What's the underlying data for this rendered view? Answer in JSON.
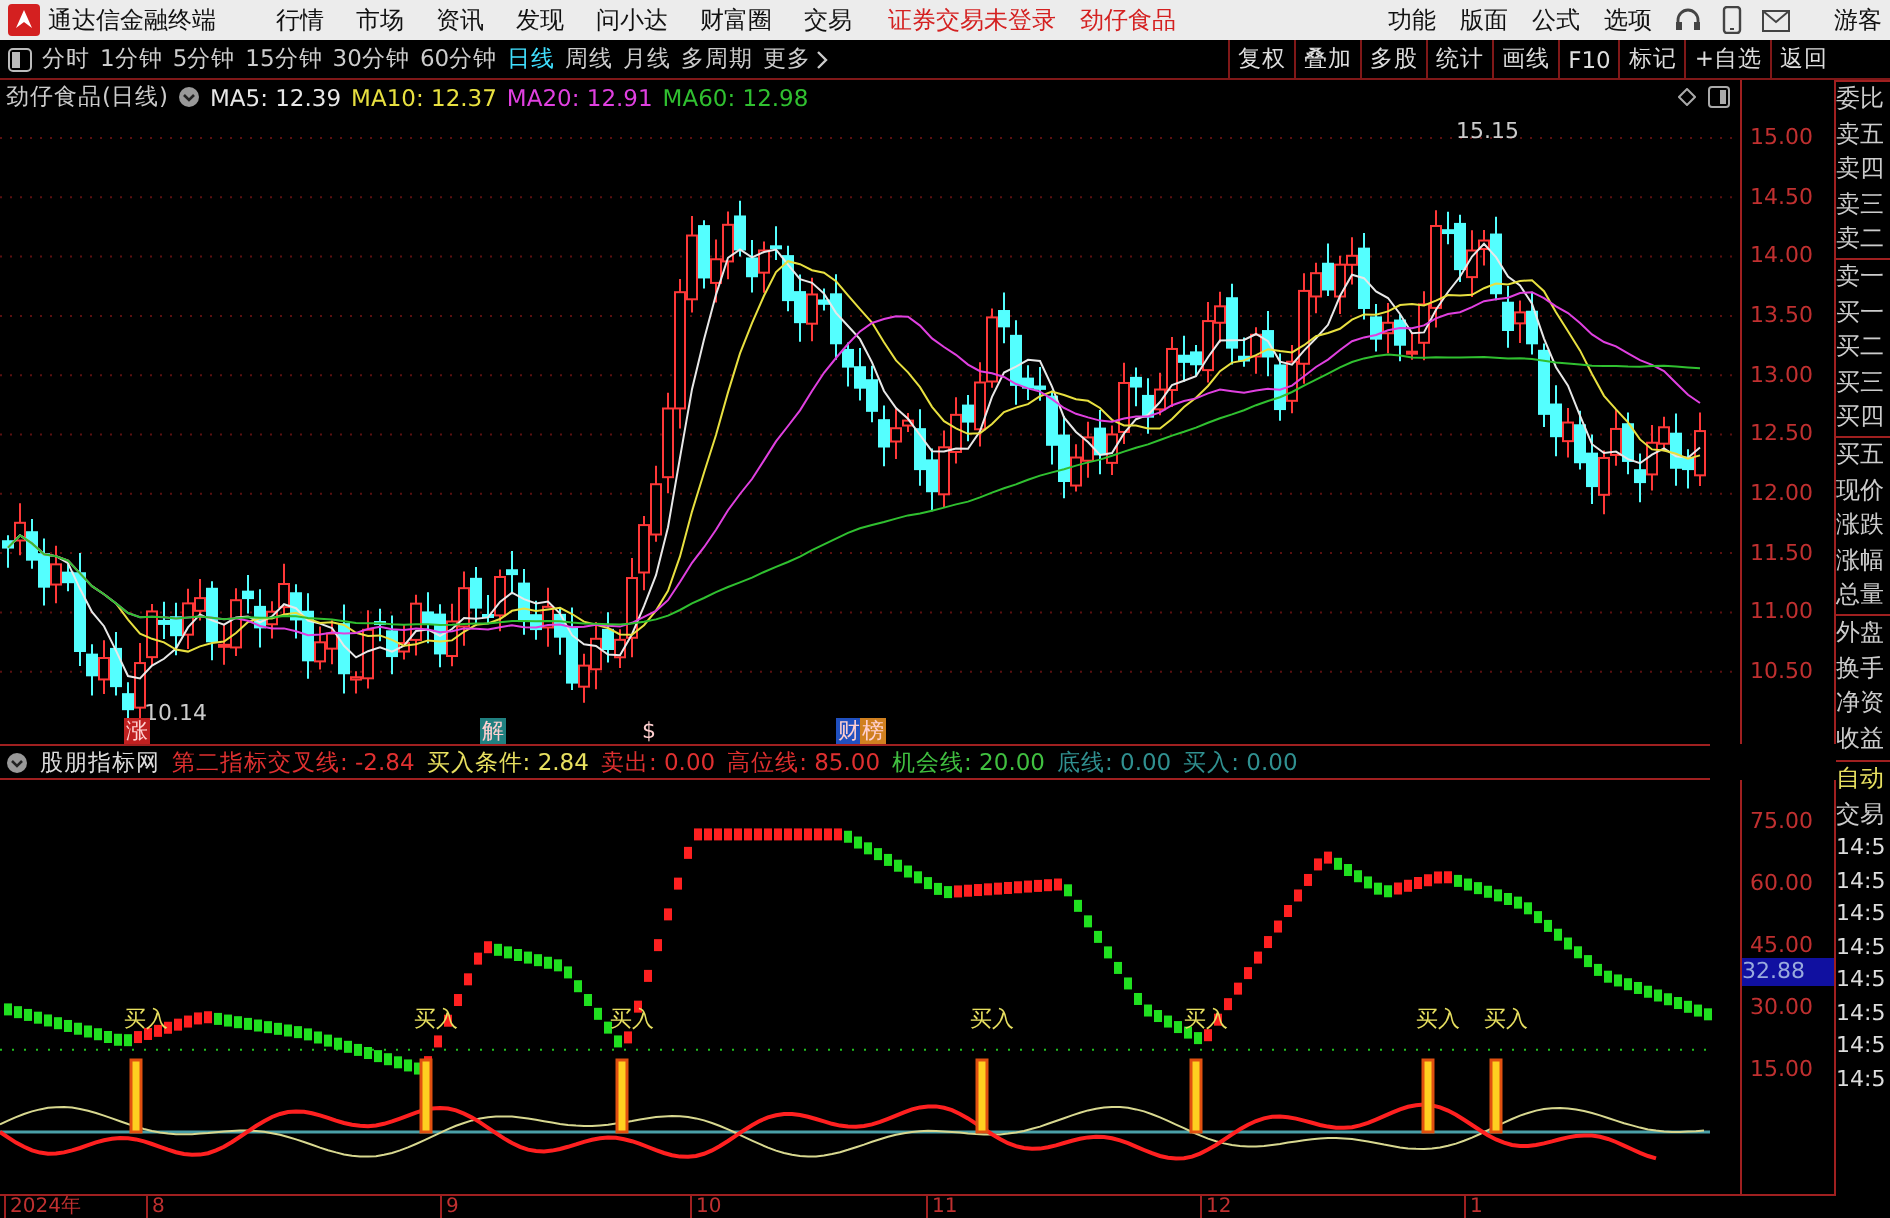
{
  "title_bar": {
    "app_name": "通达信金融终端",
    "menu": [
      "行情",
      "市场",
      "资讯",
      "发现",
      "问小达",
      "财富圈",
      "交易"
    ],
    "notice": "证券交易未登录",
    "stock": "劲仔食品",
    "tools": [
      "功能",
      "版面",
      "公式",
      "选项"
    ],
    "user": "游客"
  },
  "period_bar": {
    "periods": [
      {
        "label": "分时",
        "selected": false
      },
      {
        "label": "1分钟",
        "selected": false
      },
      {
        "label": "5分钟",
        "selected": false
      },
      {
        "label": "15分钟",
        "selected": false
      },
      {
        "label": "30分钟",
        "selected": false
      },
      {
        "label": "60分钟",
        "selected": false
      },
      {
        "label": "日线",
        "selected": true
      },
      {
        "label": "周线",
        "selected": false
      },
      {
        "label": "月线",
        "selected": false
      },
      {
        "label": "多周期",
        "selected": false
      }
    ],
    "more": "更多",
    "actions": [
      "复权",
      "叠加",
      "多股",
      "统计",
      "画线",
      "F10",
      "标记",
      "+自选",
      "返回"
    ]
  },
  "main_chart": {
    "title": "劲仔食品(日线)",
    "ma": [
      {
        "label": "MA5: 12.39",
        "color": "#e8e8e8"
      },
      {
        "label": "MA10: 12.37",
        "color": "#e8e040"
      },
      {
        "label": "MA20: 12.91",
        "color": "#e040e0"
      },
      {
        "label": "MA60: 12.98",
        "color": "#30c030"
      }
    ],
    "price_ticks": [
      "15.00",
      "14.50",
      "14.00",
      "13.50",
      "13.00",
      "12.50",
      "12.00",
      "11.50",
      "11.00",
      "10.50"
    ],
    "low_label": "10.14",
    "high_label": "15.15",
    "markers": [
      {
        "label": "涨",
        "color": "#c02020"
      },
      {
        "label": "解",
        "color": "#208080"
      },
      {
        "label": "$",
        "color": "#000000"
      },
      {
        "label": "财",
        "color": "#2050c0"
      },
      {
        "label": "榜",
        "color": "#d08020"
      }
    ]
  },
  "indicator": {
    "name": "股朋指标网",
    "values": [
      {
        "text": "第二指标交叉线: -2.84",
        "kind": "cross"
      },
      {
        "text": "买入条件: 2.84",
        "kind": "condition"
      },
      {
        "text": "卖出: 0.00",
        "kind": "sell"
      },
      {
        "text": "高位线: 85.00",
        "kind": "high"
      },
      {
        "text": "机会线: 20.00",
        "kind": "chance"
      },
      {
        "text": "底线: 0.00",
        "kind": "bottom"
      },
      {
        "text": "买入: 0.00",
        "kind": "buy"
      }
    ],
    "ticks": [
      "75.00",
      "60.00",
      "45.00",
      "30.00",
      "15.00"
    ],
    "current_value": "32.88",
    "buy_labels": [
      "买入",
      "买入",
      "买入",
      "买入",
      "买入",
      "买入",
      "买入"
    ]
  },
  "date_axis": [
    "2024年",
    "8",
    "9",
    "10",
    "11",
    "12",
    "1"
  ],
  "quote_panel": {
    "labels": [
      "委比",
      "卖五",
      "卖四",
      "卖三",
      "卖二",
      "卖一",
      "买一",
      "买二",
      "买三",
      "买四",
      "买五",
      "现价",
      "涨跌",
      "涨幅",
      "总量",
      "外盘",
      "换手",
      "净资",
      "收益"
    ]
  },
  "trade_panel": {
    "auto": "自动",
    "title": "交易",
    "times": [
      "14:5",
      "14:5",
      "14:5",
      "14:5",
      "14:5",
      "14:5",
      "14:5",
      "14:5"
    ]
  }
}
